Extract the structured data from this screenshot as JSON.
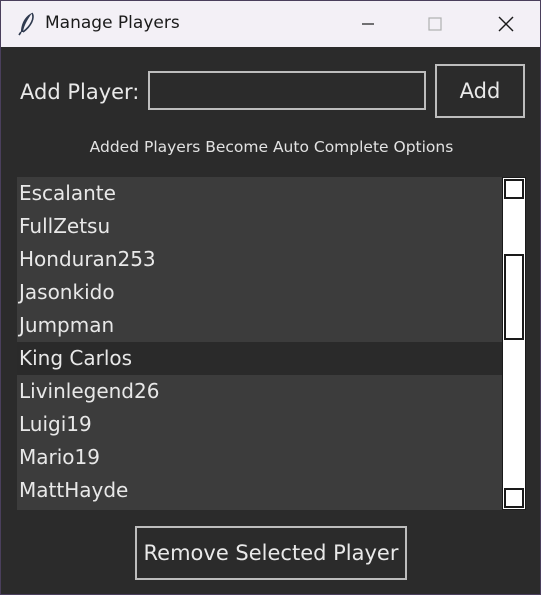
{
  "window": {
    "title": "Manage Players",
    "icon": "feather-icon",
    "controls": [
      "minimize-icon",
      "maximize-icon",
      "close-icon"
    ]
  },
  "add": {
    "label": "Add Player:",
    "input_value": "",
    "button_label": "Add"
  },
  "hint": "Added Players Become Auto Complete Options",
  "players": {
    "items": [
      "Escalante",
      "FullZetsu",
      "Honduran253",
      "Jasonkido",
      "Jumpman",
      "King Carlos",
      "Livinlegend26",
      "Luigi19",
      "Mario19",
      "MattHayde"
    ],
    "selected": "King Carlos"
  },
  "remove_button_label": "Remove Selected Player",
  "colors": {
    "background": "#2b2b2b",
    "list_background": "#3c3c3c",
    "selected_row": "#2a2a2a",
    "text": "#e8e8e8",
    "border": "#bdbdbd",
    "titlebar": "#f3f0f6"
  }
}
